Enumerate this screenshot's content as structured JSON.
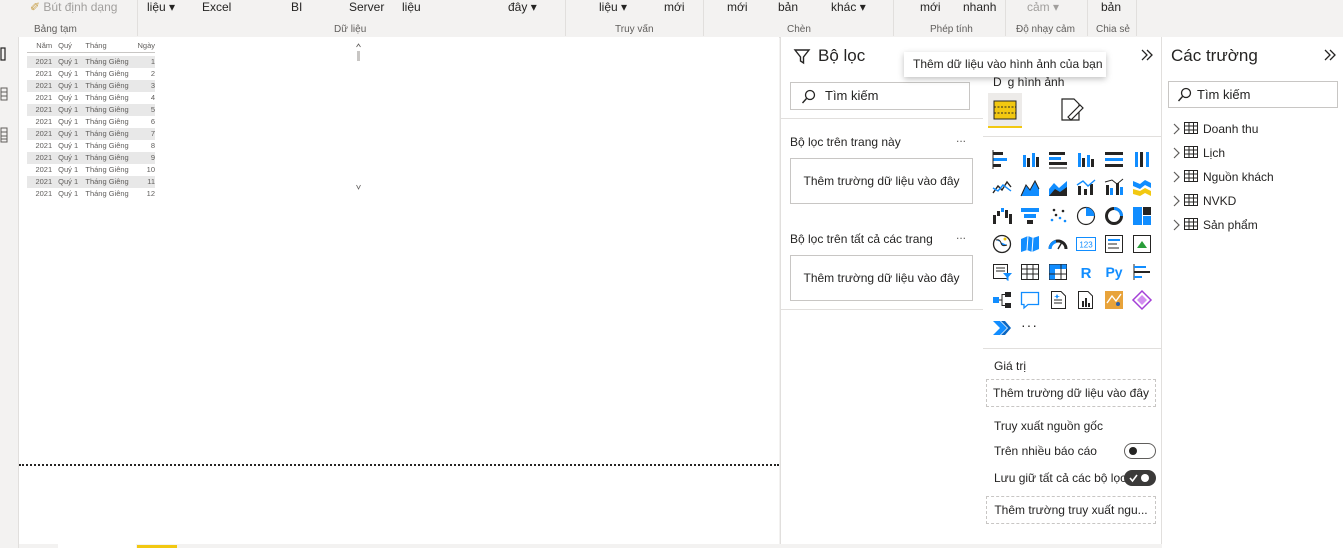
{
  "ribbon": {
    "format_painter": "Bút định dạng",
    "clipboard_group": "Bảng tạm",
    "items": [
      "liệu",
      "Excel",
      "BI",
      "Server",
      "liệu",
      "đây",
      "liệu",
      "mới",
      "mới",
      "bản",
      "khác",
      "mới",
      "nhanh",
      "cảm",
      "bản"
    ],
    "groups": [
      "Dữ liệu",
      "Truy vấn",
      "Chèn",
      "Phép tính",
      "Độ nhạy cảm",
      "Chia sẻ"
    ]
  },
  "table": {
    "headers": [
      "Năm",
      "Quý",
      "Tháng",
      "Ngày"
    ],
    "rows": [
      [
        "2021",
        "Quý 1",
        "Tháng Giêng",
        "1"
      ],
      [
        "2021",
        "Quý 1",
        "Tháng Giêng",
        "2"
      ],
      [
        "2021",
        "Quý 1",
        "Tháng Giêng",
        "3"
      ],
      [
        "2021",
        "Quý 1",
        "Tháng Giêng",
        "4"
      ],
      [
        "2021",
        "Quý 1",
        "Tháng Giêng",
        "5"
      ],
      [
        "2021",
        "Quý 1",
        "Tháng Giêng",
        "6"
      ],
      [
        "2021",
        "Quý 1",
        "Tháng Giêng",
        "7"
      ],
      [
        "2021",
        "Quý 1",
        "Tháng Giêng",
        "8"
      ],
      [
        "2021",
        "Quý 1",
        "Tháng Giêng",
        "9"
      ],
      [
        "2021",
        "Quý 1",
        "Tháng Giêng",
        "10"
      ],
      [
        "2021",
        "Quý 1",
        "Tháng Giêng",
        "11"
      ],
      [
        "2021",
        "Quý 1",
        "Tháng Giêng",
        "12"
      ]
    ]
  },
  "filters": {
    "title": "Bộ lọc",
    "search_placeholder": "Tìm kiếm",
    "section_page": "Bộ lọc trên trang này",
    "section_all": "Bộ lọc trên tất cả các trang",
    "drop_label": "Thêm trường dữ liệu vào đây",
    "more": "..."
  },
  "viz": {
    "tooltip": "Thêm dữ liệu vào hình ảnh của bạn",
    "header_partial": "D...g hình ảnh",
    "header_visible": "g hình ảnh",
    "values_label": "Giá trị",
    "values_drop": "Thêm trường dữ liệu vào đây",
    "drillthrough_title": "Truy xuất nguồn gốc",
    "cross_report": "Trên nhiều báo cáo",
    "keep_filters": "Lưu giữ tất cả các bộ lọc",
    "drillthrough_drop": "Thêm trường truy xuất ngu...",
    "more": "···"
  },
  "fields": {
    "title": "Các trường",
    "search_placeholder": "Tìm kiếm",
    "tables": [
      "Doanh thu",
      "Lịch",
      "Nguồn khách",
      "NVKD",
      "Sản phẩm"
    ]
  },
  "colors": {
    "accent": "#f2c811",
    "blue": "#118dff",
    "text": "#252423"
  }
}
